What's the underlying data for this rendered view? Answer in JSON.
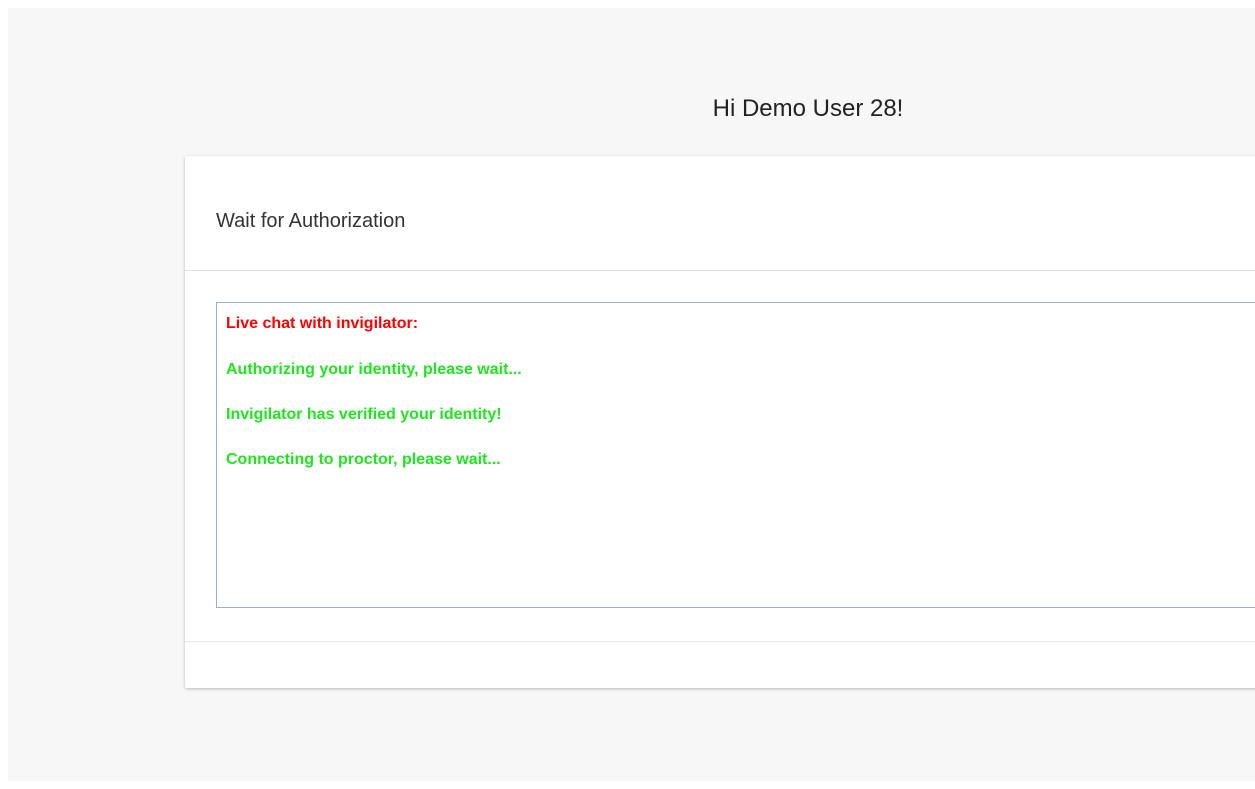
{
  "greeting": "Hi Demo User 28!",
  "card": {
    "title": "Wait for Authorization"
  },
  "chat": {
    "header": "Live chat with invigilator:",
    "messages": [
      "Authorizing your identity, please wait...",
      "Invigilator has verified your identity!",
      "Connecting to proctor, please wait..."
    ]
  },
  "colors": {
    "chat_header": "#ff0000",
    "chat_message": "#1ee61e",
    "page_background": "#f7f7f7",
    "card_background": "#ffffff"
  }
}
